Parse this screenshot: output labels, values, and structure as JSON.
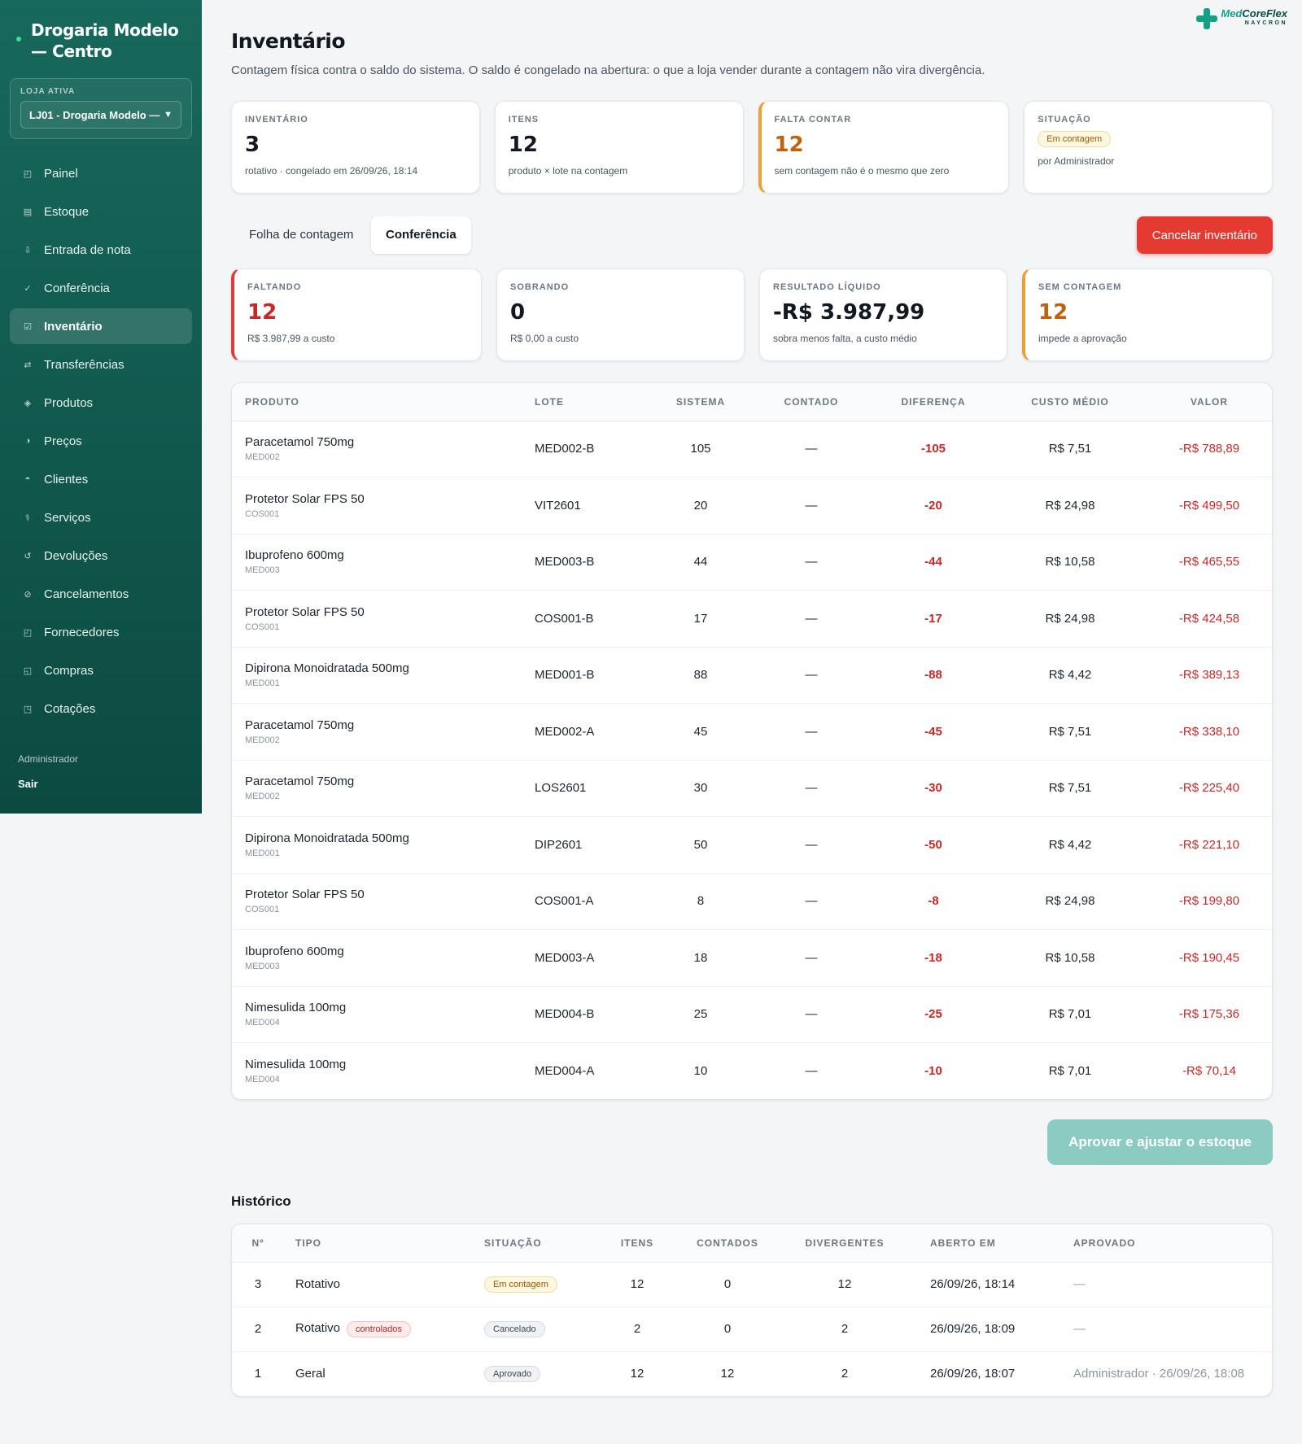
{
  "sidebar": {
    "brand": "Drogaria Modelo — Centro",
    "store_label": "LOJA ATIVA",
    "store_selected": "LJ01 - Drogaria Modelo —",
    "items": [
      {
        "label": "Painel",
        "icon": "dashboard-icon",
        "glyph": "◰"
      },
      {
        "label": "Estoque",
        "icon": "stock-icon",
        "glyph": "▤"
      },
      {
        "label": "Entrada de nota",
        "icon": "download-icon",
        "glyph": "⇩"
      },
      {
        "label": "Conferência",
        "icon": "check-icon",
        "glyph": "✓"
      },
      {
        "label": "Inventário",
        "icon": "checkbox-icon",
        "glyph": "☑"
      },
      {
        "label": "Transferências",
        "icon": "transfer-icon",
        "glyph": "⇄"
      },
      {
        "label": "Produtos",
        "icon": "diamond-icon",
        "glyph": "◈"
      },
      {
        "label": "Preços",
        "icon": "price-icon",
        "glyph": "◑"
      },
      {
        "label": "Clientes",
        "icon": "clients-icon",
        "glyph": "◓"
      },
      {
        "label": "Serviços",
        "icon": "services-icon",
        "glyph": "⚕"
      },
      {
        "label": "Devoluções",
        "icon": "return-icon",
        "glyph": "↺"
      },
      {
        "label": "Cancelamentos",
        "icon": "cancel-icon",
        "glyph": "⊘"
      },
      {
        "label": "Fornecedores",
        "icon": "suppliers-icon",
        "glyph": "◰"
      },
      {
        "label": "Compras",
        "icon": "purchases-icon",
        "glyph": "◱"
      },
      {
        "label": "Cotações",
        "icon": "quotes-icon",
        "glyph": "◳"
      }
    ],
    "active_index": 4,
    "user": "Administrador",
    "logout": "Sair"
  },
  "logo": {
    "part1": "Med",
    "part2": "CoreFlex",
    "sub": "NAYCRON"
  },
  "header": {
    "title": "Inventário",
    "subtitle": "Contagem física contra o saldo do sistema. O saldo é congelado na abertura: o que a loja vender durante a contagem não vira divergência."
  },
  "summary": {
    "inventario": {
      "label": "INVENTÁRIO",
      "value": "3",
      "note": "rotativo · congelado em 26/09/26, 18:14"
    },
    "itens": {
      "label": "ITENS",
      "value": "12",
      "note": "produto × lote na contagem"
    },
    "falta_contar": {
      "label": "FALTA CONTAR",
      "value": "12",
      "note": "sem contagem não é o mesmo que zero"
    },
    "situacao": {
      "label": "SITUAÇÃO",
      "badge": "Em contagem",
      "note": "por Administrador"
    }
  },
  "tabs": {
    "folha": "Folha de contagem",
    "conferencia": "Conferência"
  },
  "actions": {
    "cancel": "Cancelar inventário",
    "approve": "Aprovar e ajustar o estoque"
  },
  "results": {
    "faltando": {
      "label": "FALTANDO",
      "value": "12",
      "note": "R$ 3.987,99 a custo"
    },
    "sobrando": {
      "label": "SOBRANDO",
      "value": "0",
      "note": "R$ 0,00 a custo"
    },
    "liquido": {
      "label": "RESULTADO LÍQUIDO",
      "value": "-R$ 3.987,99",
      "note": "sobra menos falta, a custo médio"
    },
    "sem_contagem": {
      "label": "SEM CONTAGEM",
      "value": "12",
      "note": "impede a aprovação"
    }
  },
  "inventory_table": {
    "headers": {
      "produto": "PRODUTO",
      "lote": "LOTE",
      "sistema": "SISTEMA",
      "contado": "CONTADO",
      "diferenca": "DIFERENÇA",
      "custo": "CUSTO MÉDIO",
      "valor": "VALOR"
    },
    "rows": [
      {
        "name": "Paracetamol 750mg",
        "code": "MED002",
        "lote": "MED002-B",
        "sistema": "105",
        "contado": "—",
        "diferenca": "-105",
        "custo": "R$ 7,51",
        "valor": "-R$ 788,89"
      },
      {
        "name": "Protetor Solar FPS 50",
        "code": "COS001",
        "lote": "VIT2601",
        "sistema": "20",
        "contado": "—",
        "diferenca": "-20",
        "custo": "R$ 24,98",
        "valor": "-R$ 499,50"
      },
      {
        "name": "Ibuprofeno 600mg",
        "code": "MED003",
        "lote": "MED003-B",
        "sistema": "44",
        "contado": "—",
        "diferenca": "-44",
        "custo": "R$ 10,58",
        "valor": "-R$ 465,55"
      },
      {
        "name": "Protetor Solar FPS 50",
        "code": "COS001",
        "lote": "COS001-B",
        "sistema": "17",
        "contado": "—",
        "diferenca": "-17",
        "custo": "R$ 24,98",
        "valor": "-R$ 424,58"
      },
      {
        "name": "Dipirona Monoidratada 500mg",
        "code": "MED001",
        "lote": "MED001-B",
        "sistema": "88",
        "contado": "—",
        "diferenca": "-88",
        "custo": "R$ 4,42",
        "valor": "-R$ 389,13"
      },
      {
        "name": "Paracetamol 750mg",
        "code": "MED002",
        "lote": "MED002-A",
        "sistema": "45",
        "contado": "—",
        "diferenca": "-45",
        "custo": "R$ 7,51",
        "valor": "-R$ 338,10"
      },
      {
        "name": "Paracetamol 750mg",
        "code": "MED002",
        "lote": "LOS2601",
        "sistema": "30",
        "contado": "—",
        "diferenca": "-30",
        "custo": "R$ 7,51",
        "valor": "-R$ 225,40"
      },
      {
        "name": "Dipirona Monoidratada 500mg",
        "code": "MED001",
        "lote": "DIP2601",
        "sistema": "50",
        "contado": "—",
        "diferenca": "-50",
        "custo": "R$ 4,42",
        "valor": "-R$ 221,10"
      },
      {
        "name": "Protetor Solar FPS 50",
        "code": "COS001",
        "lote": "COS001-A",
        "sistema": "8",
        "contado": "—",
        "diferenca": "-8",
        "custo": "R$ 24,98",
        "valor": "-R$ 199,80"
      },
      {
        "name": "Ibuprofeno 600mg",
        "code": "MED003",
        "lote": "MED003-A",
        "sistema": "18",
        "contado": "—",
        "diferenca": "-18",
        "custo": "R$ 10,58",
        "valor": "-R$ 190,45"
      },
      {
        "name": "Nimesulida 100mg",
        "code": "MED004",
        "lote": "MED004-B",
        "sistema": "25",
        "contado": "—",
        "diferenca": "-25",
        "custo": "R$ 7,01",
        "valor": "-R$ 175,36"
      },
      {
        "name": "Nimesulida 100mg",
        "code": "MED004",
        "lote": "MED004-A",
        "sistema": "10",
        "contado": "—",
        "diferenca": "-10",
        "custo": "R$ 7,01",
        "valor": "-R$ 70,14"
      }
    ]
  },
  "history": {
    "title": "Histórico",
    "headers": {
      "num": "Nº",
      "tipo": "TIPO",
      "situacao": "SITUAÇÃO",
      "itens": "ITENS",
      "contados": "CONTADOS",
      "divergentes": "DIVERGENTES",
      "aberto": "ABERTO EM",
      "aprovado": "APROVADO"
    },
    "rows": [
      {
        "num": "3",
        "tipo": "Rotativo",
        "tag": "",
        "situacao": "Em contagem",
        "status_style": "warn",
        "itens": "12",
        "contados": "0",
        "divergentes": "12",
        "aberto": "26/09/26, 18:14",
        "aprovado": "—"
      },
      {
        "num": "2",
        "tipo": "Rotativo",
        "tag": "controlados",
        "situacao": "Cancelado",
        "status_style": "grey",
        "itens": "2",
        "contados": "0",
        "divergentes": "2",
        "aberto": "26/09/26, 18:09",
        "aprovado": "—"
      },
      {
        "num": "1",
        "tipo": "Geral",
        "tag": "",
        "situacao": "Aprovado",
        "status_style": "grey",
        "itens": "12",
        "contados": "12",
        "divergentes": "2",
        "aberto": "26/09/26, 18:07",
        "aprovado": "Administrador · 26/09/26, 18:08"
      }
    ]
  }
}
